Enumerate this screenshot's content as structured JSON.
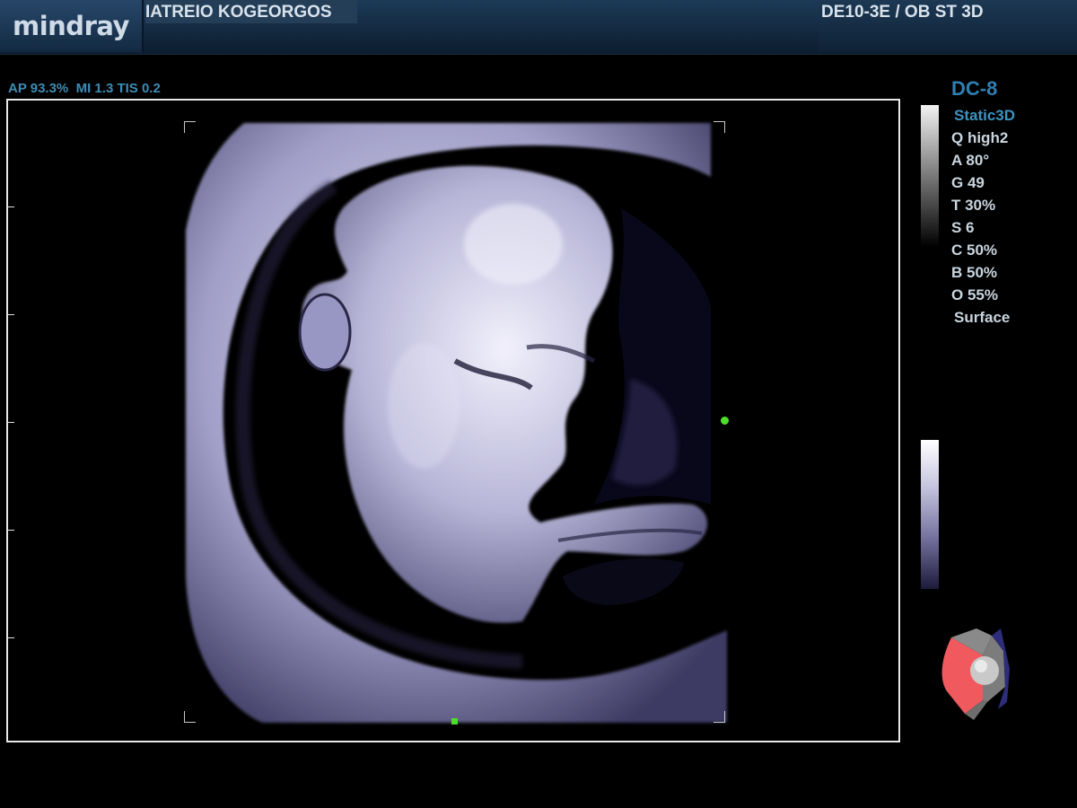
{
  "header": {
    "logo": "mindray",
    "hospital": "IATREIO KOGEORGOS",
    "probe_preset": "DE10-3E / OB ST 3D"
  },
  "acoustic_output": "AP 93.3%  MI 1.3 TIS 0.2",
  "imaging_params": {
    "mode": "DC-8",
    "items": [
      "Static3D",
      "Q high2",
      "A 80°",
      "G 49",
      "T 30%",
      "S 6",
      "C 50%",
      "B 50%",
      "O 55%",
      "Surface"
    ]
  },
  "colors": {
    "accent": "#3d92c0",
    "tint": "#c9c7e0",
    "marker": "#4cdf2a"
  },
  "icons": [
    "orientation-cube-icon",
    "grayscale-bar",
    "tint-color-bar",
    "depth-marker-icon",
    "volume-marker-icon"
  ]
}
